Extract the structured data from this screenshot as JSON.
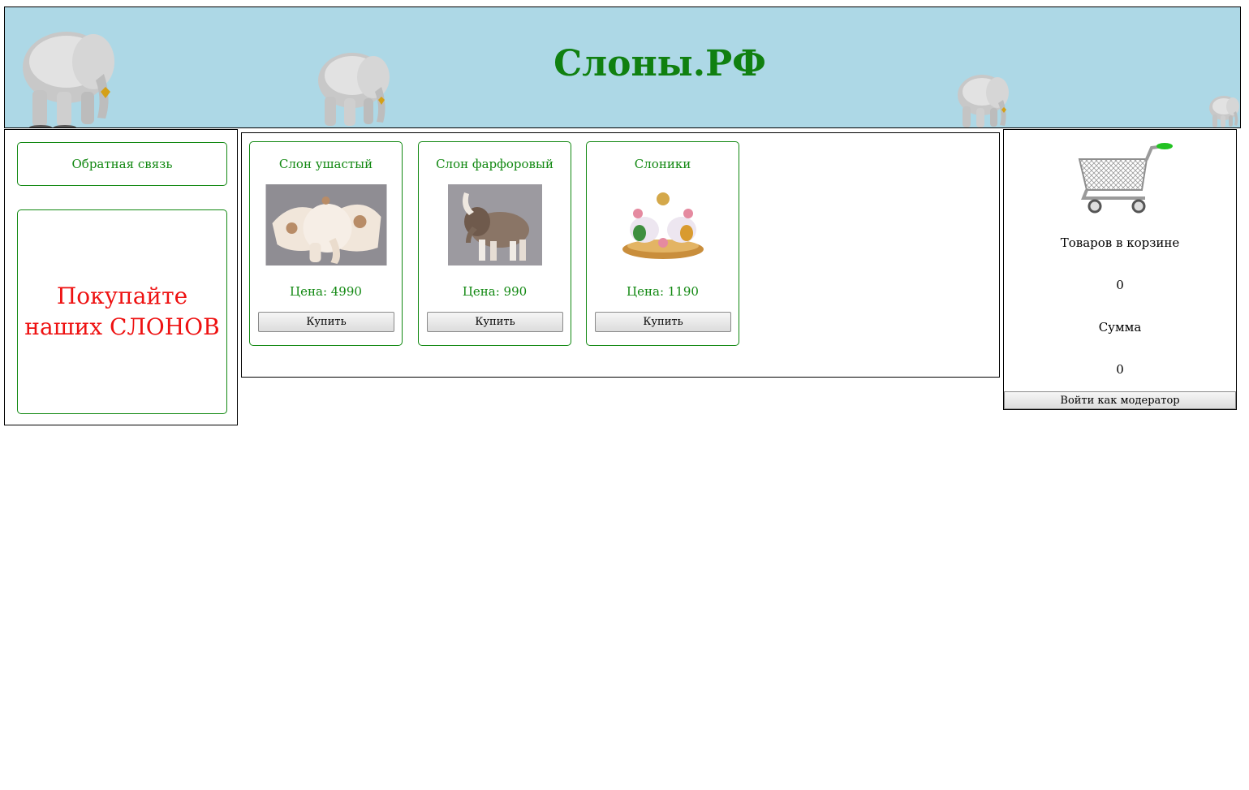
{
  "header": {
    "title": "Слоны.РФ",
    "background_color": "#add8e6",
    "title_color": "#108010",
    "decoration_icon": "elephant-figurine"
  },
  "sidebar": {
    "feedback_label": "Обратная связь",
    "promo_text": "Покупайте наших СЛОНОВ",
    "promo_color": "#ee1111"
  },
  "products": [
    {
      "name": "Слон ушастый",
      "price_label": "Цена: 4990",
      "button_label": "Купить",
      "image": "white-eared-elephant-figurine"
    },
    {
      "name": "Слон фарфоровый",
      "price_label": "Цена: 990",
      "button_label": "Купить",
      "image": "porcelain-elephant-figurine"
    },
    {
      "name": "Слоники",
      "price_label": "Цена: 1190",
      "button_label": "Купить",
      "image": "pair-of-elephants-figurine"
    }
  ],
  "cart": {
    "icon": "shopping-cart-icon",
    "items_label": "Товаров в корзине",
    "items_count": "0",
    "sum_label": "Сумма",
    "sum_value": "0",
    "moderator_button": "Войти как модератор"
  },
  "colors": {
    "accent_green": "#118811",
    "border": "#000000"
  }
}
